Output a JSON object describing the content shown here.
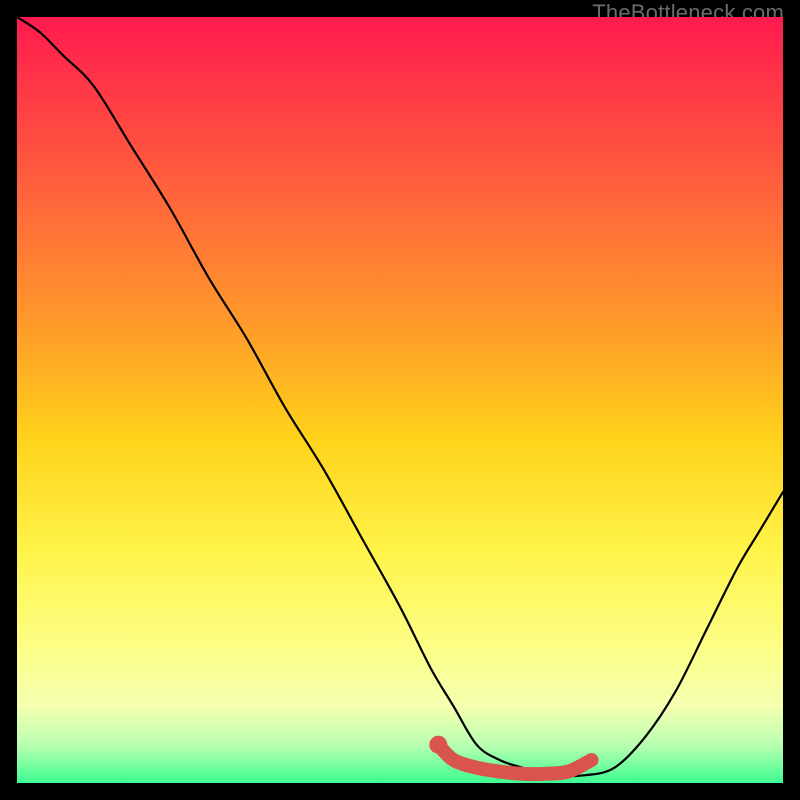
{
  "watermark": {
    "text": "TheBottleneck.com"
  },
  "colors": {
    "background": "#000000",
    "curve": "#000000",
    "marker": "#d9544d",
    "gradient_stops": [
      "#ff1a4f",
      "#ff3a46",
      "#ff6a3a",
      "#ff9a2a",
      "#ffd21a",
      "#fff44a",
      "#fcff8a",
      "#f4ffb0",
      "#baffb0",
      "#3cfc92"
    ]
  },
  "chart_data": {
    "type": "line",
    "title": "",
    "xlabel": "",
    "ylabel": "",
    "xlim": [
      0,
      100
    ],
    "ylim": [
      0,
      100
    ],
    "grid": false,
    "annotations": [],
    "series": [
      {
        "name": "bottleneck-curve",
        "x": [
          0,
          3,
          6,
          10,
          15,
          20,
          25,
          30,
          35,
          40,
          45,
          50,
          54,
          57,
          60,
          63,
          66,
          70,
          74,
          78,
          82,
          86,
          90,
          94,
          97,
          100
        ],
        "y": [
          100,
          98,
          95,
          91,
          83,
          75,
          66,
          58,
          49,
          41,
          32,
          23,
          15,
          10,
          5,
          3,
          2,
          1,
          1,
          2,
          6,
          12,
          20,
          28,
          33,
          38
        ]
      },
      {
        "name": "optimal-region-marker",
        "x": [
          55,
          57,
          60,
          63,
          66,
          69,
          72,
          75
        ],
        "y": [
          5,
          3,
          2,
          1.5,
          1.2,
          1.2,
          1.5,
          3
        ]
      }
    ]
  }
}
